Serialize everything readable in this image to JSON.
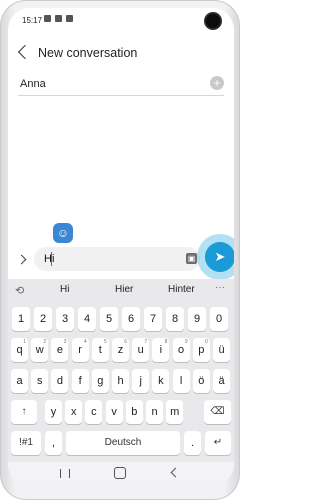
{
  "status_bar": {
    "time": "15:17"
  },
  "header": {
    "title": "New conversation"
  },
  "recipient": {
    "name": "Anna",
    "add_symbol": "+"
  },
  "composer": {
    "text": "Hi",
    "send_symbol": "➤",
    "sticker_symbol": "☺"
  },
  "keyboard": {
    "suggestions": [
      "Hi",
      "Hier",
      "Hinter"
    ],
    "more_symbol": "···",
    "row_numbers": [
      "1",
      "2",
      "3",
      "4",
      "5",
      "6",
      "7",
      "8",
      "9",
      "0"
    ],
    "row1": [
      "q",
      "w",
      "e",
      "r",
      "t",
      "z",
      "u",
      "i",
      "o",
      "p",
      "ü"
    ],
    "row1_sup": [
      "1",
      "2",
      "3",
      "4",
      "5",
      "6",
      "7",
      "8",
      "9",
      "0",
      ""
    ],
    "row2": [
      "a",
      "s",
      "d",
      "f",
      "g",
      "h",
      "j",
      "k",
      "l",
      "ö",
      "ä"
    ],
    "row3": [
      "↑",
      "y",
      "x",
      "c",
      "v",
      "b",
      "n",
      "m",
      "⌫"
    ],
    "row4": [
      "!#1",
      ",",
      "Deutsch",
      ".",
      "↵"
    ]
  },
  "colors": {
    "accent": "#1a9ad6",
    "sticker": "#3b87d6"
  }
}
